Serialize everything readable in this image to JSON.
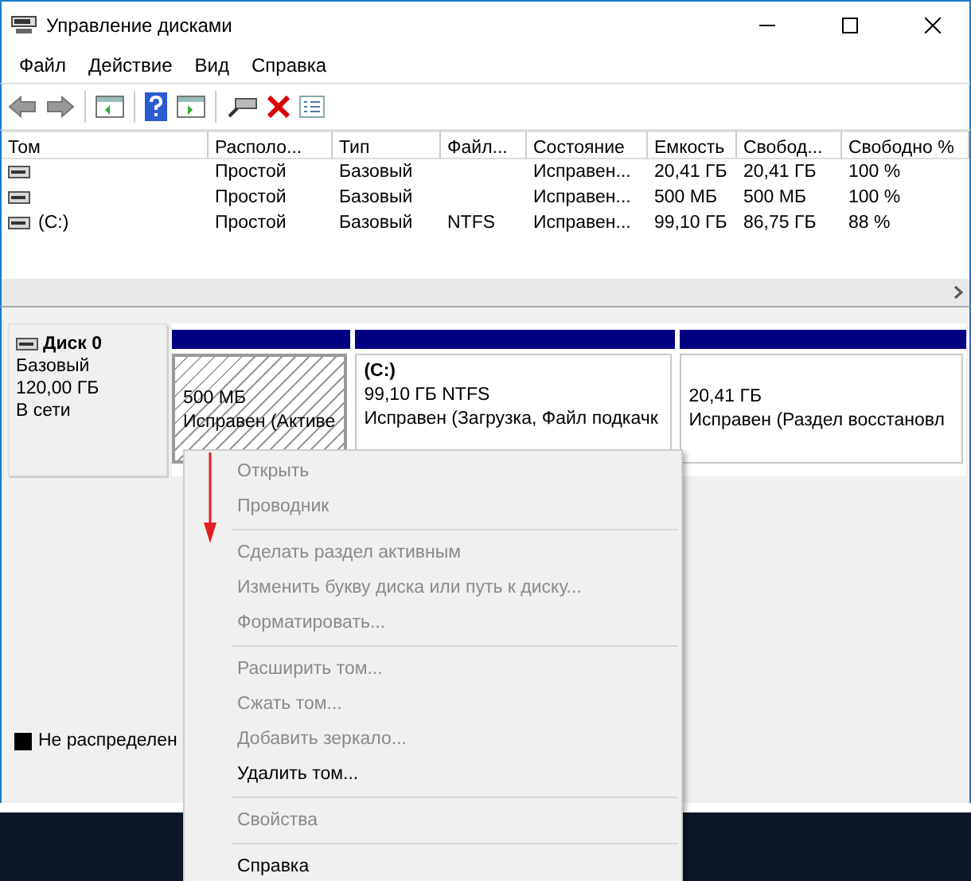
{
  "window": {
    "title": "Управление дисками"
  },
  "menu": [
    "Файл",
    "Действие",
    "Вид",
    "Справка"
  ],
  "table": {
    "columns": [
      "Том",
      "Располо...",
      "Тип",
      "Файл...",
      "Состояние",
      "Емкость",
      "Свобод...",
      "Свободно %"
    ],
    "rows": [
      {
        "cells": [
          "",
          "Простой",
          "Базовый",
          "",
          "Исправен...",
          "20,41 ГБ",
          "20,41 ГБ",
          "100 %"
        ]
      },
      {
        "cells": [
          "",
          "Простой",
          "Базовый",
          "",
          "Исправен...",
          "500 МБ",
          "500 МБ",
          "100 %"
        ]
      },
      {
        "cells": [
          "(C:)",
          "Простой",
          "Базовый",
          "NTFS",
          "Исправен...",
          "99,10 ГБ",
          "86,75 ГБ",
          "88 %"
        ]
      }
    ]
  },
  "disk": {
    "name": "Диск 0",
    "type": "Базовый",
    "size": "120,00 ГБ",
    "status": "В сети",
    "partitions": [
      {
        "size": "500 МБ",
        "status": "Исправен (Активе",
        "selected": true
      },
      {
        "label": "(C:)",
        "size": "99,10 ГБ NTFS",
        "status": "Исправен (Загрузка, Файл подкачк",
        "selected": false
      },
      {
        "size": "20,41 ГБ",
        "status": "Исправен (Раздел восстановл",
        "selected": false
      }
    ]
  },
  "legend": [
    {
      "label": "Не распределен",
      "color": "#000000"
    }
  ],
  "context_menu": [
    {
      "kind": "item",
      "label": "Открыть",
      "disabled": true
    },
    {
      "kind": "item",
      "label": "Проводник",
      "disabled": true
    },
    {
      "kind": "separator"
    },
    {
      "kind": "item",
      "label": "Сделать раздел активным",
      "disabled": true
    },
    {
      "kind": "item",
      "label": "Изменить букву диска или путь к диску...",
      "disabled": true
    },
    {
      "kind": "item",
      "label": "Форматировать...",
      "disabled": true
    },
    {
      "kind": "separator"
    },
    {
      "kind": "item",
      "label": "Расширить том...",
      "disabled": true
    },
    {
      "kind": "item",
      "label": "Сжать том...",
      "disabled": true
    },
    {
      "kind": "item",
      "label": "Добавить зеркало...",
      "disabled": true
    },
    {
      "kind": "item",
      "label": "Удалить том...",
      "disabled": false
    },
    {
      "kind": "separator"
    },
    {
      "kind": "item",
      "label": "Свойства",
      "disabled": true
    },
    {
      "kind": "separator"
    },
    {
      "kind": "item",
      "label": "Справка",
      "disabled": false
    }
  ]
}
